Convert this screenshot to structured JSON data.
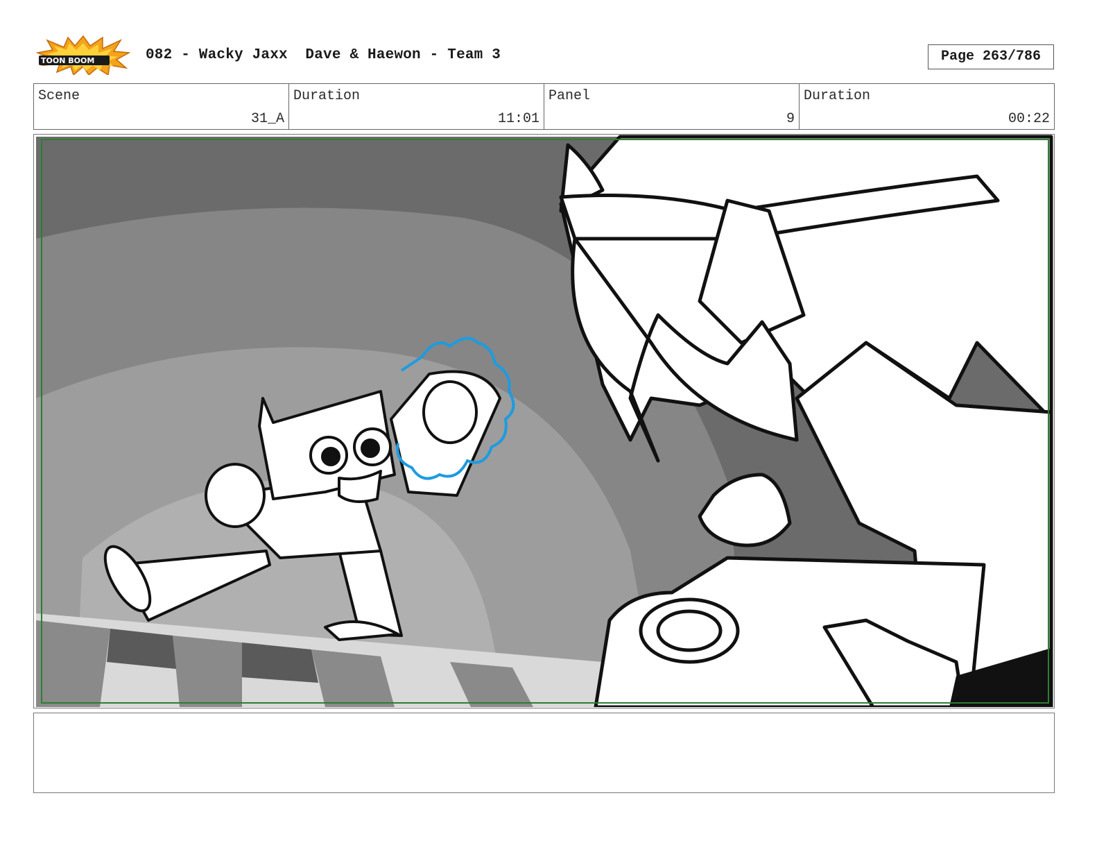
{
  "header": {
    "logo_text": "TOON BOOM",
    "title": "082 - Wacky Jaxx  Dave & Haewon - Team 3",
    "page": "Page 263/786"
  },
  "info": {
    "scene_label": "Scene",
    "scene_value": "31_A",
    "duration_label": "Duration",
    "duration_value": "11:01",
    "panel_label": "Panel",
    "panel_value": "9",
    "panel_duration_label": "Duration",
    "panel_duration_value": "00:22"
  },
  "colors": {
    "logo_orange": "#f5a21c",
    "safe_frame_green": "#2e7d32",
    "highlight_blue": "#1e9be0"
  },
  "notes": ""
}
